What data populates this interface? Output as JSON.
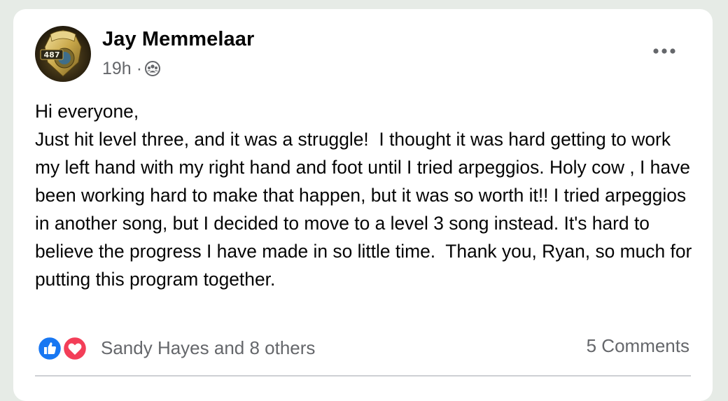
{
  "post": {
    "author": {
      "name": "Jay Memmelaar",
      "avatar_badge_number": "487"
    },
    "timestamp": "19h",
    "separator": "·",
    "audience_icon": "group-audience-icon",
    "more_icon": "more-options-icon",
    "body": "Hi everyone,\nJust hit level three, and it was a struggle!  I thought it was hard getting to work my left hand with my right hand and foot until I tried arpeggios. Holy cow , I have been working hard to make that happen, but it was so worth it!! I tried arpeggios in another song, but I decided to move to a level 3 song instead. It's hard to believe the progress I have made in so little time.  Thank you, Ryan, so much for putting this program together."
  },
  "reactions": {
    "icons": [
      "like-reaction-icon",
      "love-reaction-icon"
    ],
    "summary": "Sandy Hayes and 8 others"
  },
  "comments": {
    "summary": "5 Comments"
  },
  "colors": {
    "like_blue": "#1877f2",
    "love_red": "#f33e58",
    "secondary_text": "#65676b",
    "primary_text": "#050505"
  }
}
